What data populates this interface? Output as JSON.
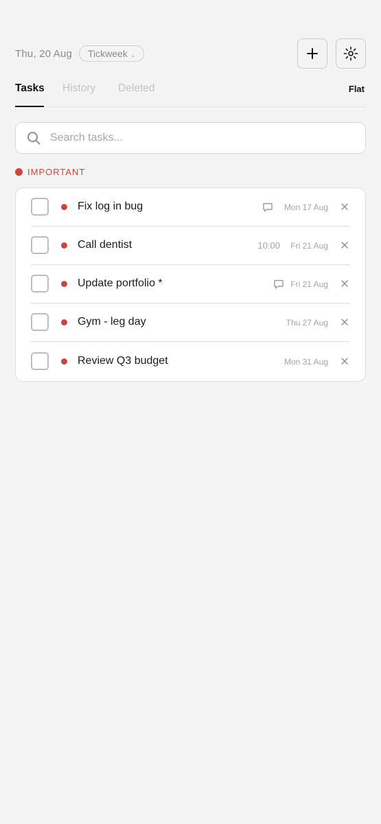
{
  "header": {
    "date": "Thu, 20 Aug",
    "workspace": "Tickweek",
    "workspace_chevron": "⌄",
    "add_icon": "plus-icon",
    "settings_icon": "sun-gear-icon"
  },
  "tabs": {
    "items": [
      {
        "label": "Tasks",
        "active": true
      },
      {
        "label": "History",
        "active": false
      },
      {
        "label": "Deleted",
        "active": false
      }
    ],
    "view_mode": "Flat"
  },
  "search": {
    "placeholder": "Search tasks...",
    "value": ""
  },
  "section": {
    "label": "IMPORTANT",
    "color": "#c9463f"
  },
  "tasks": [
    {
      "title": "Fix log in bug",
      "date": "Mon 17 Aug",
      "time": "",
      "has_comment": true
    },
    {
      "title": "Call dentist",
      "date": "Fri 21 Aug",
      "time": "10:00",
      "has_comment": false
    },
    {
      "title": "Update portfolio *",
      "date": "Fri 21 Aug",
      "time": "",
      "has_comment": true
    },
    {
      "title": "Gym - leg day",
      "date": "Thu 27 Aug",
      "time": "",
      "has_comment": false
    },
    {
      "title": "Review Q3 budget",
      "date": "Mon 31 Aug",
      "time": "",
      "has_comment": false
    }
  ],
  "colors": {
    "background": "#f4f4f4",
    "accent_red": "#c9463f",
    "muted_text": "#8a8a8a"
  }
}
